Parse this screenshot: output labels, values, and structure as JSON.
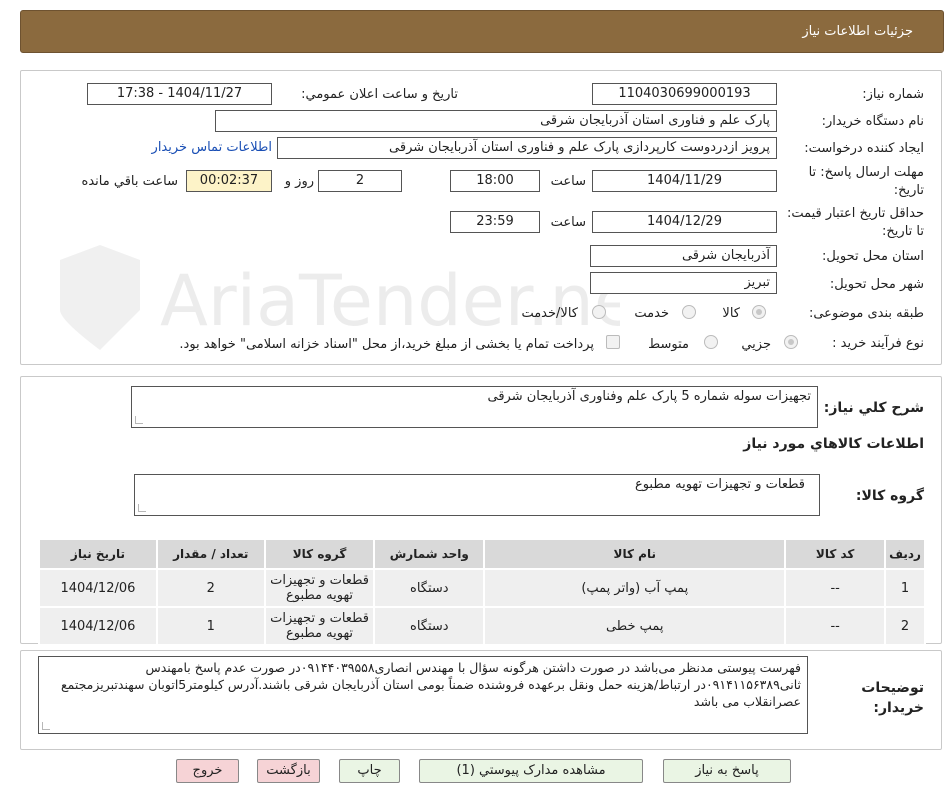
{
  "header": {
    "title": "جزئیات اطلاعات نیاز"
  },
  "fields": {
    "need_number_label": "شماره نیاز:",
    "need_number": "1104030699000193",
    "announce_label": "تاریخ و ساعت اعلان عمومي:",
    "announce_value": "1404/11/27 - 17:38",
    "buyer_org_label": "نام دستگاه خریدار:",
    "buyer_org": "پارک علم و فناوری استان آذربایجان شرقی",
    "creator_label": "ایجاد کننده درخواست:",
    "creator": "پرویز ازدردوست کارپردازی پارک علم و فناوری استان آذربایجان شرقی",
    "contact_link": "اطلاعات تماس خریدار",
    "send_deadline_label": "مهلت ارسال پاسخ: تا تاریخ:",
    "send_date": "1404/11/29",
    "time_label": "ساعت",
    "send_time": "18:00",
    "days_value": "2",
    "days_label": "روز و",
    "remaining_time": "00:02:37",
    "remaining_label": "ساعت باقي مانده",
    "validity_label": "حداقل تاریخ اعتبار قیمت: تا تاریخ:",
    "validity_date": "1404/12/29",
    "validity_time": "23:59",
    "province_label": "استان محل تحویل:",
    "province": "آذربایجان شرقی",
    "city_label": "شهر محل تحویل:",
    "city": "تبریز",
    "category_label": "طبقه بندی موضوعی:",
    "category_options": [
      "کالا",
      "خدمت",
      "کالا/خدمت"
    ],
    "process_label": "نوع فرآیند خرید :",
    "process_options": [
      "جزیي",
      "متوسط"
    ],
    "payment_note": "پرداخت تمام یا بخشی از مبلغ خرید،از محل \"اسناد خزانه اسلامی\" خواهد بود."
  },
  "description": {
    "label": "شرح کلي نياز:",
    "value": "تجهیزات سوله شماره 5 پارک علم وفناوری آذربایجان شرقی"
  },
  "goods_section": {
    "title": "اطلاعات کالاهاي مورد نياز",
    "group_label": "گروه کالا:",
    "group_value": "قطعات و تجهیزات تهویه مطبوع"
  },
  "table": {
    "headers": [
      "رديف",
      "کد کالا",
      "نام کالا",
      "واحد شمارش",
      "گروه کالا",
      "تعداد / مقدار",
      "تاریخ نیاز"
    ],
    "rows": [
      {
        "row": "1",
        "code": "--",
        "name": "پمپ آب (واتر پمپ)",
        "unit": "دستگاه",
        "group": "قطعات و تجهیزات تهویه مطبوع",
        "qty": "2",
        "date": "1404/12/06"
      },
      {
        "row": "2",
        "code": "--",
        "name": "پمپ خطی",
        "unit": "دستگاه",
        "group": "قطعات و تجهیزات تهویه مطبوع",
        "qty": "1",
        "date": "1404/12/06"
      }
    ]
  },
  "buyer_notes": {
    "label": "توضیحات خریدار:",
    "value": "فهرست پیوستی مدنظر می‌باشد در صورت داشتن هرگونه سؤال با مهندس انصاری۰۹۱۴۴۰۳۹۵۵۸در صورت عدم پاسخ بامهندس ثانی۰۹۱۴۱۱۵۶۳۸۹در ارتباط/هزینه حمل ونقل برعهده فروشنده ضمناً بومی استان آذربایجان شرقی باشند.آدرس کیلومتر5اتوبان سهندتبریزمجتمع عصرانقلاب می باشد"
  },
  "buttons": {
    "reply": "پاسخ به نياز",
    "attachments": "مشاهده مدارک پیوستي (1)",
    "print": "چاپ",
    "back": "بازگشت",
    "exit": "خروج"
  },
  "watermark": {
    "text": "AriaTender.neT"
  }
}
